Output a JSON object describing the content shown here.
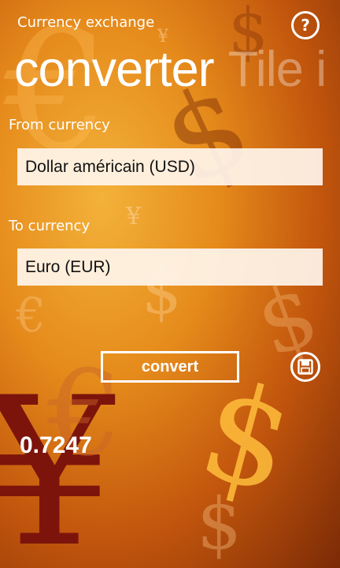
{
  "header": {
    "app_title": "Currency exchange",
    "page_title": "converter",
    "next_page_title": "Tile i"
  },
  "help_button": {
    "icon": "help-icon",
    "glyph": "?"
  },
  "from": {
    "label": "From currency",
    "value": "Dollar américain (USD)"
  },
  "to": {
    "label": "To currency",
    "value": "Euro (EUR)"
  },
  "actions": {
    "convert_label": "convert",
    "save_icon": "save-icon"
  },
  "result": {
    "value": "0.7247"
  },
  "theme": {
    "accent": "#e58a1b",
    "dark": "#7b2a06",
    "field_bg": "#fff5eb"
  }
}
